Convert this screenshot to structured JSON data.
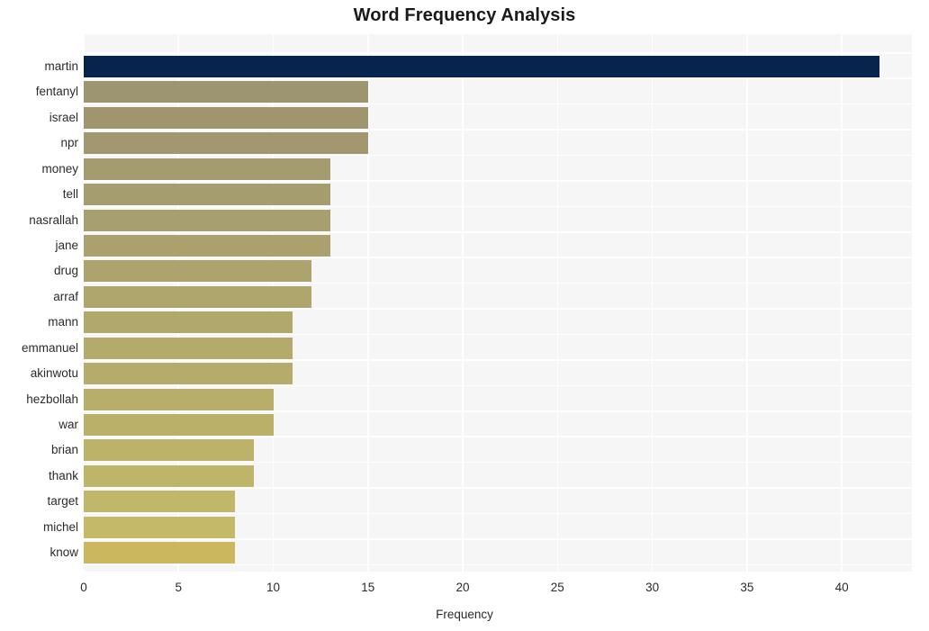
{
  "chart_data": {
    "type": "bar",
    "orientation": "horizontal",
    "title": "Word Frequency Analysis",
    "xlabel": "Frequency",
    "ylabel": "",
    "categories": [
      "martin",
      "fentanyl",
      "israel",
      "npr",
      "money",
      "tell",
      "nasrallah",
      "jane",
      "drug",
      "arraf",
      "mann",
      "emmanuel",
      "akinwotu",
      "hezbollah",
      "war",
      "brian",
      "thank",
      "target",
      "michel",
      "know"
    ],
    "values": [
      42,
      15,
      15,
      15,
      13,
      13,
      13,
      13,
      12,
      12,
      11,
      11,
      11,
      10,
      10,
      9,
      9,
      8,
      8,
      8
    ],
    "bar_colors": [
      "#07244f",
      "#9d9471",
      "#9f9670",
      "#a19870",
      "#a49b6f",
      "#a69d6f",
      "#a89f6e",
      "#aaa16e",
      "#ada46d",
      "#afa66d",
      "#b1a86c",
      "#b3aa6c",
      "#b5ac6b",
      "#b8ae6b",
      "#bab06a",
      "#bcb269",
      "#beb569",
      "#c1b768",
      "#c3b968",
      "#cbb85e"
    ],
    "xlim": [
      0,
      43.7
    ],
    "x_ticks": [
      0,
      5,
      10,
      15,
      20,
      25,
      30,
      35,
      40
    ],
    "x_tick_labels": [
      "0",
      "5",
      "10",
      "15",
      "20",
      "25",
      "30",
      "35",
      "40"
    ],
    "grid": true,
    "grid_color": "#ffffff",
    "plot_background": "#f6f6f6",
    "figure_background": "#ffffff",
    "legend": null
  }
}
